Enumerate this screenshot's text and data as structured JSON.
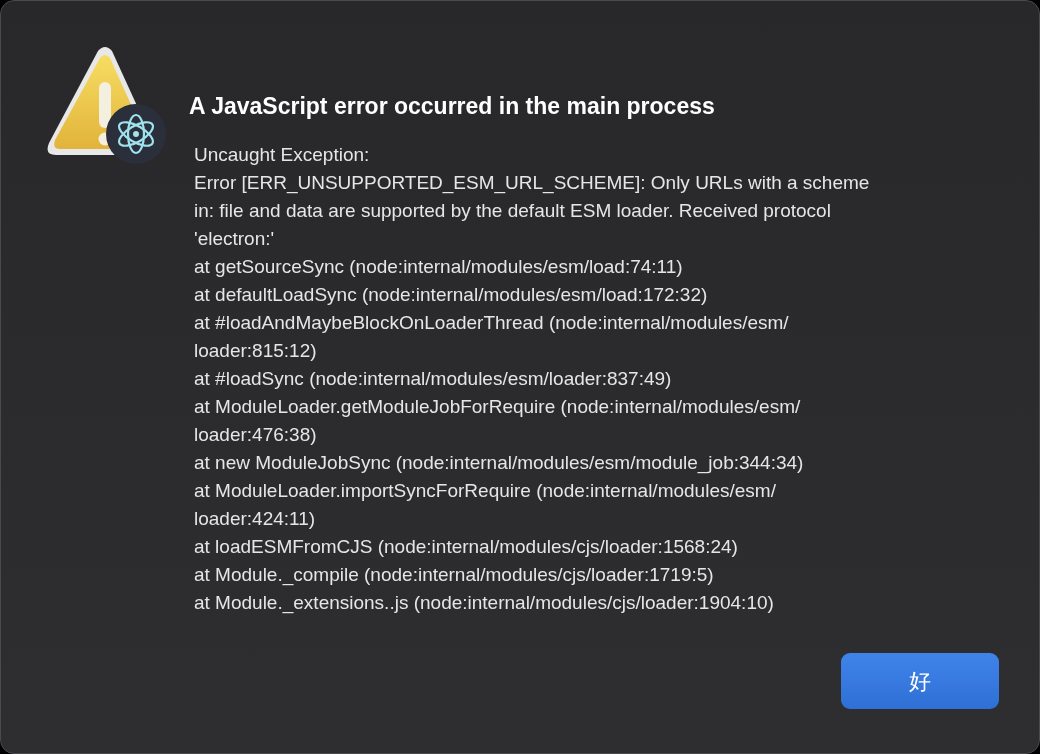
{
  "dialog": {
    "title": "A JavaScript error occurred in the main process",
    "message_lines": [
      "Uncaught Exception:",
      "Error [ERR_UNSUPPORTED_ESM_URL_SCHEME]: Only URLs with a scheme",
      "in: file and data are supported by the default ESM loader. Received protocol",
      "'electron:'",
      "at getSourceSync (node:internal/modules/esm/load:74:11)",
      "at defaultLoadSync (node:internal/modules/esm/load:172:32)",
      "at #loadAndMaybeBlockOnLoaderThread (node:internal/modules/esm/",
      "loader:815:12)",
      "at #loadSync (node:internal/modules/esm/loader:837:49)",
      "at ModuleLoader.getModuleJobForRequire (node:internal/modules/esm/",
      "loader:476:38)",
      "at new ModuleJobSync (node:internal/modules/esm/module_job:344:34)",
      "at ModuleLoader.importSyncForRequire (node:internal/modules/esm/",
      "loader:424:11)",
      "at loadESMFromCJS (node:internal/modules/cjs/loader:1568:24)",
      "at Module._compile (node:internal/modules/cjs/loader:1719:5)",
      "at Module._extensions..js (node:internal/modules/cjs/loader:1904:10)"
    ],
    "buttons": [
      {
        "label": "好"
      }
    ]
  }
}
